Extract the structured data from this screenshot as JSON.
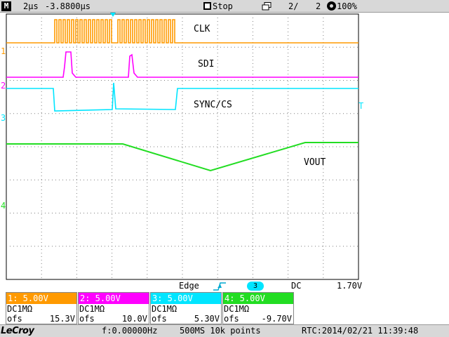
{
  "topbar": {
    "mode_badge": "M",
    "timebase": "2µs",
    "delay": "-3.8800µs",
    "run_state": "Stop",
    "acq_count": "2/",
    "acq_total": "2",
    "zoom": "100%"
  },
  "colors": {
    "ch1": "#ff9a00",
    "ch2": "#ff00ff",
    "ch3": "#00e5ff",
    "ch4": "#22dd22",
    "grid": "#7f7f7f"
  },
  "channel_markers": [
    "1",
    "2",
    "3",
    "4"
  ],
  "trigger_level_marker": "T",
  "labels": {
    "clk": "CLK",
    "sdi": "SDI",
    "sync": "SYNC/CS",
    "vout": "VOUT"
  },
  "trigger": {
    "type": "Edge",
    "source": "3",
    "coupling": "DC",
    "level": "1.70V"
  },
  "channels": [
    {
      "title": "1: 5.00V",
      "coupling": "DC1MΩ",
      "ofs_label": "ofs",
      "ofs": "15.3V"
    },
    {
      "title": "2: 5.00V",
      "coupling": "DC1MΩ",
      "ofs_label": "ofs",
      "ofs": "10.0V"
    },
    {
      "title": "3: 5.00V",
      "coupling": "DC1MΩ",
      "ofs_label": "ofs",
      "ofs": "5.30V"
    },
    {
      "title": "4: 5.00V",
      "coupling": "DC1MΩ",
      "ofs_label": "ofs",
      "ofs": "-9.70V"
    }
  ],
  "footer": {
    "brand": "LeCroy",
    "freq": "f:0.00000Hz",
    "sample": "500MS 10k points",
    "rtc": "RTC:2014/02/21 11:39:48"
  }
}
